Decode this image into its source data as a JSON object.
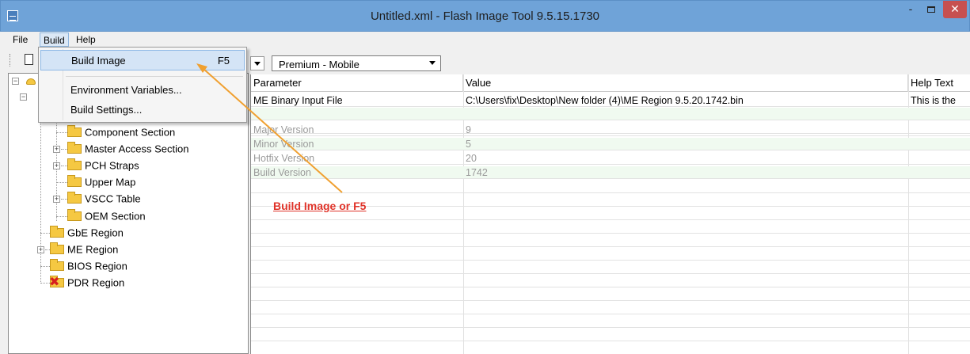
{
  "window": {
    "title": "Untitled.xml - Flash Image Tool 9.5.15.1730",
    "minimize_glyph": "-",
    "close_glyph": "✕"
  },
  "menubar": {
    "file": "File",
    "build": "Build",
    "help": "Help"
  },
  "build_menu": {
    "items": [
      {
        "label": "Build Image",
        "shortcut": "F5"
      },
      {
        "label": "Environment Variables..."
      },
      {
        "label": "Build Settings..."
      }
    ]
  },
  "toolbar": {
    "sku_select": "Premium - Mobile"
  },
  "tree": {
    "expander_minus": "−",
    "expander_plus": "+",
    "nodes": [
      {
        "label": "Component Section"
      },
      {
        "label": "Master Access Section"
      },
      {
        "label": "PCH Straps"
      },
      {
        "label": "Upper Map"
      },
      {
        "label": "VSCC Table"
      },
      {
        "label": "OEM Section"
      },
      {
        "label": "GbE Region"
      },
      {
        "label": "ME Region"
      },
      {
        "label": "BIOS Region"
      },
      {
        "label": "PDR Region"
      }
    ],
    "disabled_mark": "✖"
  },
  "grid": {
    "headers": [
      "Parameter",
      "Value",
      "Help Text"
    ],
    "rows": [
      {
        "parameter": "ME Binary Input File",
        "value": "C:\\Users\\fix\\Desktop\\New folder (4)\\ME Region 9.5.20.1742.bin",
        "help": "This is the"
      },
      {
        "parameter": "",
        "value": "",
        "help": ""
      },
      {
        "parameter": "",
        "value": "",
        "help": ""
      },
      {
        "parameter": "Major Version",
        "value": "9",
        "help": ""
      },
      {
        "parameter": "Minor Version",
        "value": "5",
        "help": ""
      },
      {
        "parameter": "Hotfix Version",
        "value": "20",
        "help": ""
      },
      {
        "parameter": "Build Version",
        "value": "1742",
        "help": ""
      }
    ]
  },
  "annotation": {
    "text": "Build Image or F5",
    "color": "#e0342a",
    "arrow_color": "#f0a030"
  }
}
